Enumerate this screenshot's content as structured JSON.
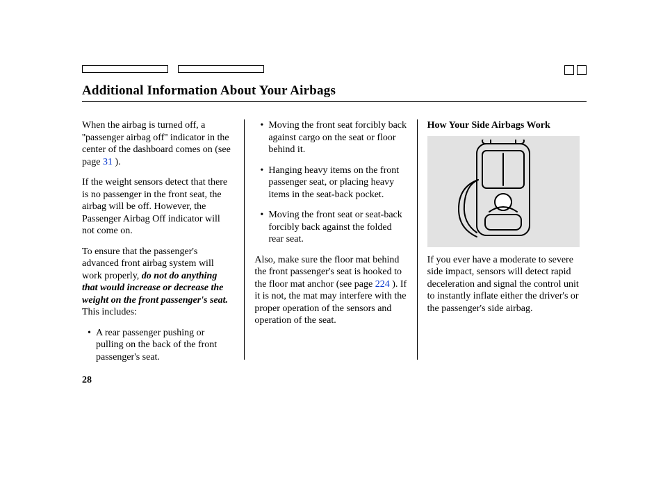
{
  "page_number": "28",
  "heading": "Additional Information About Your Airbags",
  "col1": {
    "p1_a": "When the airbag is turned off, a ''passenger airbag off'' indicator in the center of the dashboard comes on (see page ",
    "p1_link": "31",
    "p1_b": " ).",
    "p2": "If the weight sensors detect that there is no passenger in the front seat, the airbag will be off. However, the Passenger Airbag Off indicator will not come on.",
    "p3_a": "To ensure that the passenger's advanced front airbag system will work properly, ",
    "p3_em": "do not do anything that would increase or decrease the weight on the front passenger's seat.",
    "p3_b": " This includes:",
    "b1": "A rear passenger pushing or pulling on the back of the front passenger's seat."
  },
  "col2": {
    "b1": "Moving the front seat forcibly back against cargo on the seat or floor behind it.",
    "b2": "Hanging heavy items on the front passenger seat, or placing heavy items in the seat-back pocket.",
    "b3": "Moving the front seat or seat-back forcibly back against the folded rear seat.",
    "p1_a": "Also, make sure the floor mat behind the front passenger's seat is hooked to the floor mat anchor (see page ",
    "p1_link": "224",
    "p1_b": " ). If it is not, the mat may interfere with the proper operation of the sensors and operation of the seat."
  },
  "col3": {
    "subhead": "How Your Side Airbags Work",
    "p1": "If you ever have a moderate to severe side impact, sensors will detect rapid deceleration and signal the control unit to instantly inflate either the driver's or the passenger's side airbag."
  }
}
